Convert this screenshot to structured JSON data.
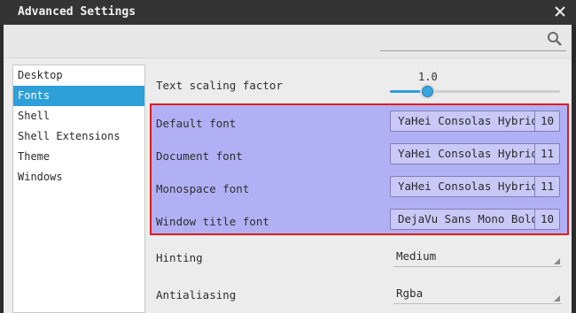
{
  "window": {
    "title": "Advanced Settings"
  },
  "search": {
    "placeholder": ""
  },
  "sidebar": {
    "items": [
      {
        "label": "Desktop"
      },
      {
        "label": "Fonts",
        "selected": true
      },
      {
        "label": "Shell"
      },
      {
        "label": "Shell Extensions"
      },
      {
        "label": "Theme"
      },
      {
        "label": "Windows"
      }
    ]
  },
  "fonts_panel": {
    "scaling": {
      "label": "Text scaling factor",
      "value": "1.0",
      "slider_fraction": 0.22
    },
    "fonts": [
      {
        "label": "Default font",
        "family": "YaHei Consolas Hybrid",
        "size": "10"
      },
      {
        "label": "Document font",
        "family": "YaHei Consolas Hybrid",
        "size": "11"
      },
      {
        "label": "Monospace font",
        "family": "YaHei Consolas Hybrid",
        "size": "11"
      },
      {
        "label": "Window title font",
        "family": "DejaVu Sans Mono Bold",
        "size": "10"
      }
    ],
    "hinting": {
      "label": "Hinting",
      "value": "Medium"
    },
    "antialiasing": {
      "label": "Antialiasing",
      "value": "Rgba"
    }
  },
  "colors": {
    "accent": "#2d9fd9",
    "highlight_fill": "#b2b0f5",
    "highlight_border": "#e41b1b",
    "titlebar": "#343434"
  },
  "icons": {
    "close": "close-icon",
    "search": "search-icon",
    "dropdown": "chevron-down-icon"
  }
}
